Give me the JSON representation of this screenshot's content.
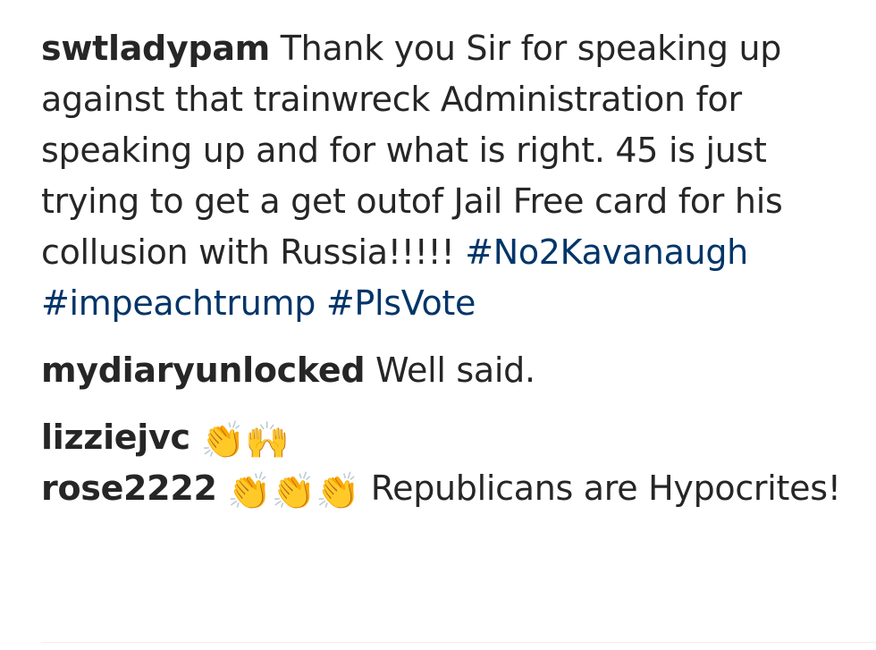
{
  "colors": {
    "text": "#262626",
    "hashtag": "#003569",
    "divider": "#efefef",
    "emoji": "#f5b72a"
  },
  "comments": [
    {
      "username": "swtladypam",
      "text": "Thank you Sir for speaking up against that trainwreck Administration for speaking up and for what is right. 45 is just trying to get a get outof Jail Free card for his collusion with Russia!!!!!",
      "hashtags": [
        "#No2Kavanaugh",
        "#impeachtrump",
        "#PlsVote"
      ]
    },
    {
      "username": "mydiaryunlocked",
      "text": "Well said."
    },
    {
      "username": "lizziejvc",
      "emojis": [
        "clapping-hands-icon",
        "raising-hands-icon"
      ]
    },
    {
      "username": "rose2222",
      "emojis": [
        "clapping-hands-icon",
        "clapping-hands-icon",
        "clapping-hands-icon"
      ],
      "text": "Republicans are Hypocrites!"
    }
  ]
}
